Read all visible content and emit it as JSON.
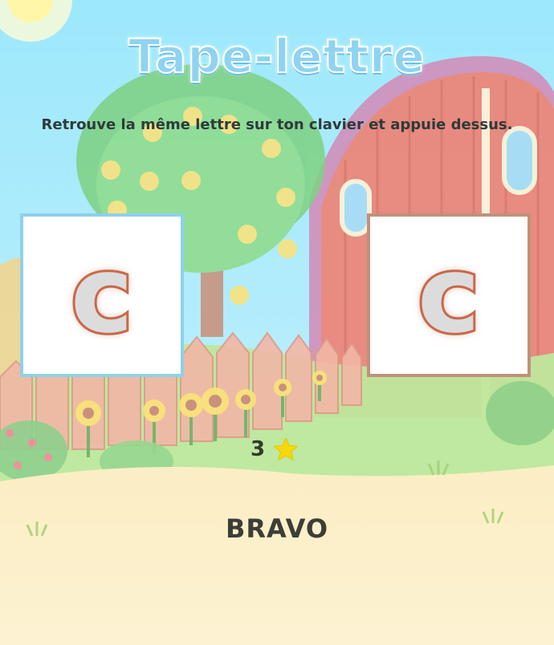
{
  "game": {
    "title": "Tape-lettre",
    "instruction": "Retrouve la même lettre sur ton clavier et appuie dessus.",
    "target_letter": "c",
    "typed_letter": "c",
    "score": "3",
    "feedback": "BRAVO"
  },
  "colors": {
    "sky": "#9de6fb",
    "title_fill": "#8fd3f1",
    "target_border": "#8fd0ea",
    "answer_border": "#c0917a",
    "letter_outline": "#c96a4a",
    "star": "#f5d90a"
  },
  "icons": {
    "score": "star-icon"
  }
}
